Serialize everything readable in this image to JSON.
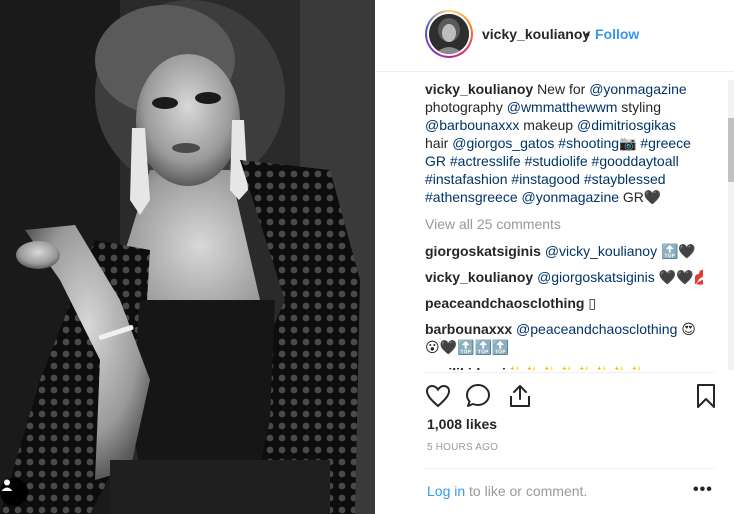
{
  "header": {
    "username": "vicky_koulianoy",
    "separator": "•",
    "follow_label": "Follow"
  },
  "caption": {
    "username": "vicky_koulianoy",
    "lines": [
      [
        "New for ",
        "@yonmagazine"
      ],
      [
        "photography ",
        "@wmmatthewwm",
        " styling"
      ],
      [
        "@barbounaxxx",
        " makeup ",
        "@dimitriosgikas"
      ],
      [
        "hair ",
        "@giorgos_gatos",
        " ",
        "#shooting📷",
        " ",
        "#greece"
      ],
      [
        "GR",
        " ",
        "#actresslife",
        " ",
        "#studiolife",
        " ",
        "#gooddaytoall"
      ],
      [
        "#instafashion",
        " ",
        "#instagood",
        " ",
        "#stayblessed"
      ],
      [
        "#athensgreece",
        " ",
        "@yonmagazine",
        " GR🖤"
      ]
    ]
  },
  "view_all_label": "View all 25 comments",
  "comments": [
    {
      "user": "giorgoskatsiginis",
      "mention": "@vicky_koulianoy",
      "text": " 🔝🖤"
    },
    {
      "user": "vicky_koulianoy",
      "mention": "@giorgoskatsiginis",
      "text": " 🖤🖤💋"
    },
    {
      "user": "peaceandchaosclothing",
      "mention": "",
      "text": " ▯"
    },
    {
      "user": "barbounaxxx",
      "mention": "@peaceandchaosclothing",
      "text": " 😍",
      "extra": "😮🖤🔝🔝🔝"
    },
    {
      "user": "vasilikidrosi",
      "mention": "",
      "text": "✨✨✨✨✨✨✨✨"
    }
  ],
  "likes_label": "1,008 likes",
  "time_label": "5 HOURS AGO",
  "login": {
    "link": "Log in",
    "rest": " to like or comment."
  },
  "more_label": "•••",
  "icons": {
    "like": "heart-icon",
    "comment": "comment-bubble-icon",
    "share": "share-icon",
    "save": "bookmark-icon",
    "tag": "user-tag-icon",
    "more": "more-options-icon"
  },
  "colors": {
    "link": "#003569",
    "follow": "#3897f0",
    "muted": "#999999",
    "text": "#262626"
  }
}
